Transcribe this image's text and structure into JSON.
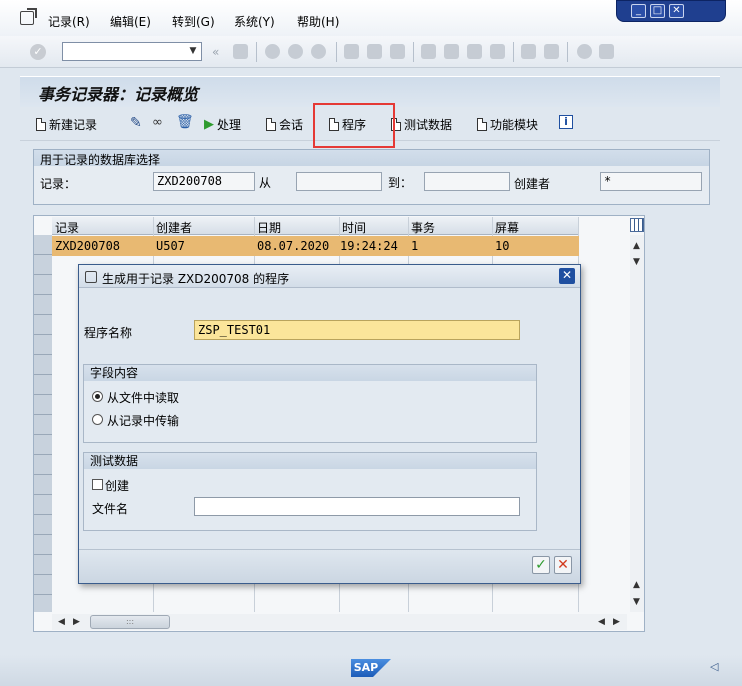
{
  "menu": {
    "items": [
      "记录(R)",
      "编辑(E)",
      "转到(G)",
      "系统(Y)",
      "帮助(H)"
    ]
  },
  "window": {
    "title": "事务记录器：记录概览"
  },
  "app_toolbar": {
    "new_recording": "新建记录",
    "process": "处理",
    "session": "会话",
    "program": "程序",
    "test_data": "测试数据",
    "function_module": "功能模块"
  },
  "selection": {
    "group_title": "用于记录的数据库选择",
    "record_label": "记录：",
    "record_value": "ZXD200708",
    "from_label": "从",
    "from_value": "",
    "to_label": "到：",
    "to_value": "",
    "creator_label": "创建者",
    "creator_value": "*"
  },
  "table": {
    "columns": [
      "记录",
      "创建者",
      "日期",
      "时间",
      "事务",
      "屏幕"
    ],
    "rows": [
      [
        "ZXD200708",
        "U507",
        "08.07.2020",
        "19:24:24",
        "1",
        "10"
      ]
    ]
  },
  "dialog": {
    "title": "生成用于记录 ZXD200708 的程序",
    "program_name_label": "程序名称",
    "program_name_value": "ZSP_TEST01",
    "field_content_title": "字段内容",
    "radio_read_file": "从文件中读取",
    "radio_transfer_record": "从记录中传输",
    "test_data_title": "测试数据",
    "create_label": "创建",
    "file_name_label": "文件名",
    "file_name_value": ""
  },
  "brand": {
    "logo": "SAP"
  },
  "colors": {
    "selected_row": "#e8b972",
    "input_highlight": "#fbe59a",
    "annotation": "#e53935"
  }
}
